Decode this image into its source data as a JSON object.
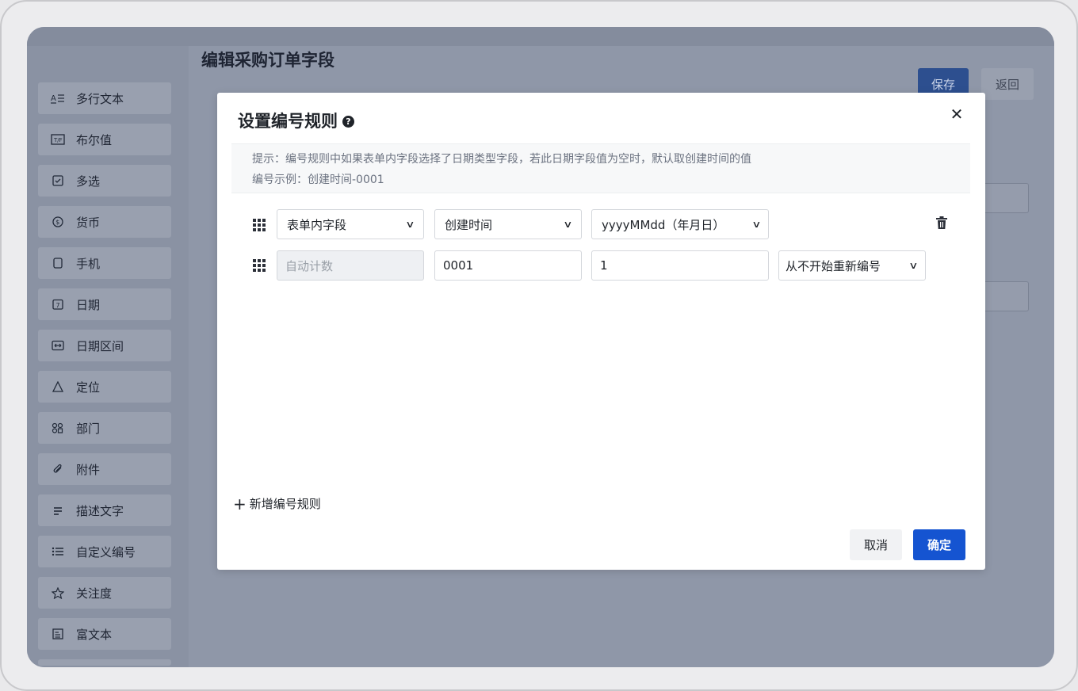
{
  "page": {
    "title": "编辑采购订单字段",
    "save_label": "保存",
    "back_label": "返回"
  },
  "sidebar": {
    "items": [
      {
        "label": "多行文本",
        "icon": "multiline-text-icon"
      },
      {
        "label": "布尔值",
        "icon": "boolean-icon"
      },
      {
        "label": "多选",
        "icon": "checkbox-icon"
      },
      {
        "label": "货币",
        "icon": "currency-icon"
      },
      {
        "label": "手机",
        "icon": "phone-icon"
      },
      {
        "label": "日期",
        "icon": "calendar-icon"
      },
      {
        "label": "日期区间",
        "icon": "date-range-icon"
      },
      {
        "label": "定位",
        "icon": "location-icon"
      },
      {
        "label": "部门",
        "icon": "department-icon"
      },
      {
        "label": "附件",
        "icon": "paperclip-icon"
      },
      {
        "label": "描述文字",
        "icon": "description-icon"
      },
      {
        "label": "自定义编号",
        "icon": "numbered-list-icon"
      },
      {
        "label": "关注度",
        "icon": "star-icon"
      },
      {
        "label": "富文本",
        "icon": "rich-text-icon"
      }
    ]
  },
  "modal": {
    "title": "设置编号规则",
    "hint_line1": "提示：编号规则中如果表单内字段选择了日期类型字段，若此日期字段值为空时，默认取创建时间的值",
    "hint_line2": "编号示例：创建时间-0001",
    "row1": {
      "source": "表单内字段",
      "field": "创建时间",
      "format": "yyyyMMdd（年月日）"
    },
    "row2": {
      "source": "自动计数",
      "digits": "0001",
      "start": "1",
      "reset": "从不开始重新编号"
    },
    "add_rule_label": "新增编号规则",
    "cancel_label": "取消",
    "ok_label": "确定"
  }
}
